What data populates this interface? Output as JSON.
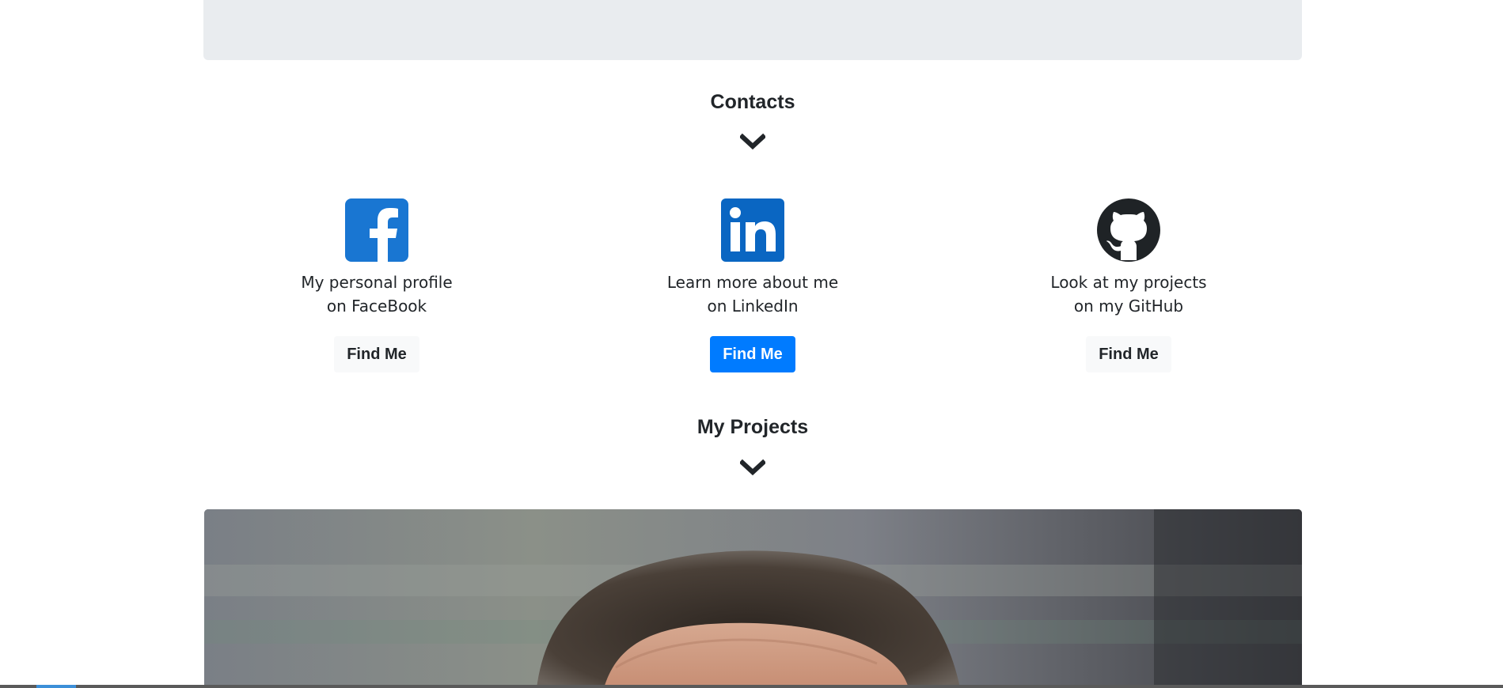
{
  "contacts_section": {
    "title": "Contacts"
  },
  "contacts": [
    {
      "network": "facebook",
      "icon": "facebook-icon",
      "line1": "My personal profile",
      "line2": "on FaceBook",
      "button_label": "Find Me",
      "brand_color": "#1877f2"
    },
    {
      "network": "linkedin",
      "icon": "linkedin-icon",
      "line1": "Learn more about me",
      "line2": "on LinkedIn",
      "button_label": "Find Me",
      "brand_color": "#0a66c2"
    },
    {
      "network": "github",
      "icon": "github-icon",
      "line1": "Look at my projects",
      "line2": "on my GitHub",
      "button_label": "Find Me",
      "brand_color": "#1b1f23"
    }
  ],
  "projects_section": {
    "title": "My Projects"
  },
  "colors": {
    "primary_button": "#007bff",
    "light_button": "#f8f9fa",
    "banner": "#e9ecef",
    "text": "#212529"
  }
}
